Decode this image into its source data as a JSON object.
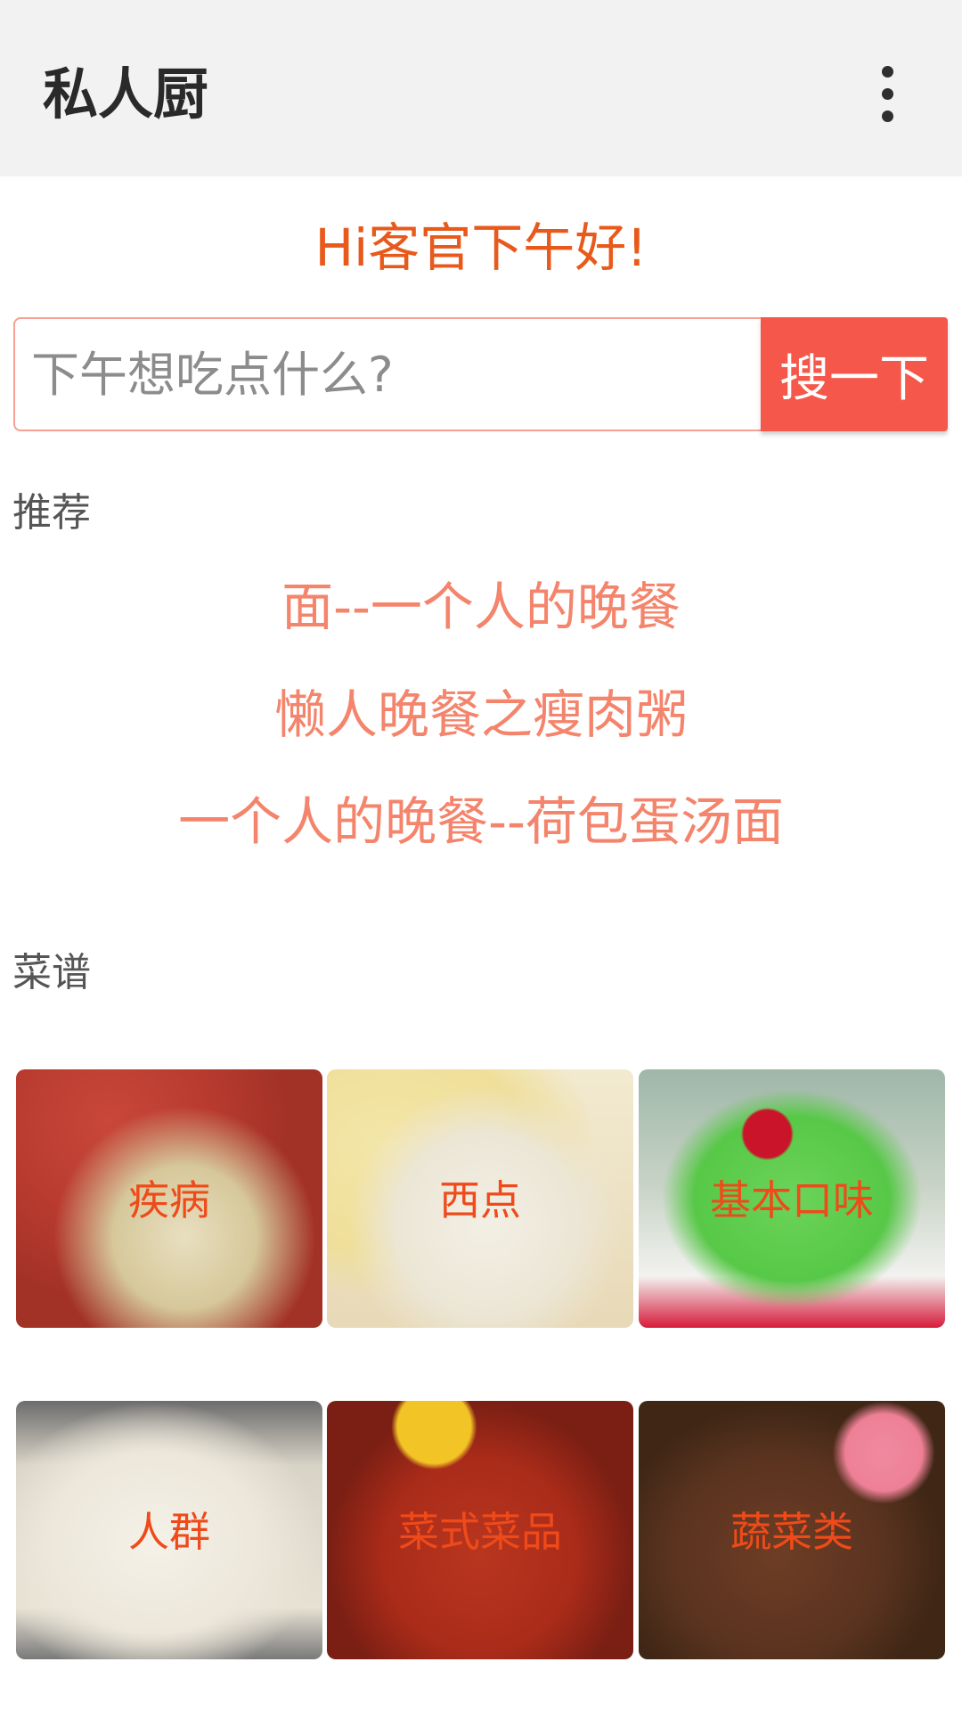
{
  "app_bar": {
    "title": "私人厨",
    "overflow_icon": "more-vert-icon"
  },
  "greeting": "Hi客官下午好!",
  "search": {
    "placeholder": "下午想吃点什么?",
    "value": "",
    "button_label": "搜一下"
  },
  "recommend": {
    "section_title": "推荐",
    "items": [
      "面--一个人的晚餐",
      "懒人晚餐之瘦肉粥",
      "一个人的晚餐--荷包蛋汤面"
    ]
  },
  "recipes": {
    "section_title": "菜谱",
    "categories": [
      {
        "label": "疾病"
      },
      {
        "label": "西点"
      },
      {
        "label": "基本口味"
      },
      {
        "label": "人群"
      },
      {
        "label": "菜式菜品"
      },
      {
        "label": "蔬菜类"
      }
    ]
  },
  "colors": {
    "greeting": "#e85a1b",
    "recommend_link": "#f4846b",
    "search_button": "#f5584a",
    "tile_label": "#ef4a1a"
  }
}
